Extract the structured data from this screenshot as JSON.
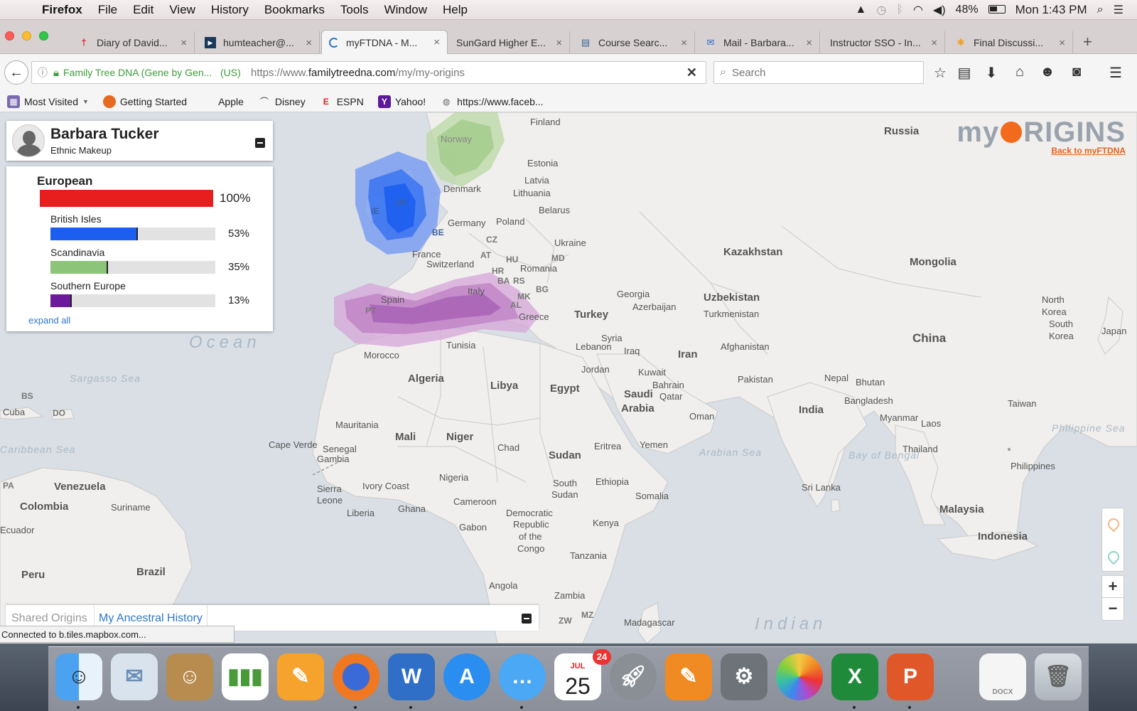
{
  "menubar": {
    "app": "Firefox",
    "items": [
      "File",
      "Edit",
      "View",
      "History",
      "Bookmarks",
      "Tools",
      "Window",
      "Help"
    ],
    "battery": "48%",
    "clock": "Mon 1:43 PM"
  },
  "tabs": [
    {
      "label": "Diary of David...",
      "icon": "cross-icon",
      "color": "#d22"
    },
    {
      "label": "humteacher@...",
      "icon": "play-icon",
      "color": "#1a3a5a"
    },
    {
      "label": "myFTDNA - M...",
      "icon": "loading-icon",
      "color": "#2b78c8"
    },
    {
      "label": "SunGard Higher E...",
      "icon": "",
      "color": ""
    },
    {
      "label": "Course Searc...",
      "icon": "document-icon",
      "color": "#3a6a9a"
    },
    {
      "label": "Mail - Barbara...",
      "icon": "mail-icon",
      "color": "#2b6ac8"
    },
    {
      "label": "Instructor SSO - In...",
      "icon": "",
      "color": ""
    },
    {
      "label": "Final Discussi...",
      "icon": "star-icon",
      "color": "#f0a020"
    }
  ],
  "nav": {
    "identity": "Family Tree DNA (Gene by Gen...",
    "identity_country": "(US)",
    "url_prefix": "https://www.",
    "url_domain": "familytreedna.com",
    "url_path": "/my/my-origins",
    "search_placeholder": "Search"
  },
  "bookmarks": [
    {
      "label": "Most Visited",
      "icon": "most-visited-icon",
      "color": "#7a6ab0"
    },
    {
      "label": "Getting Started",
      "icon": "firefox-icon",
      "color": "#e66a20"
    },
    {
      "label": "Apple",
      "icon": "apple-icon",
      "color": "#555"
    },
    {
      "label": "Disney",
      "icon": "disney-icon",
      "color": "#333"
    },
    {
      "label": "ESPN",
      "icon": "espn-icon",
      "color": "#d22"
    },
    {
      "label": "Yahoo!",
      "icon": "yahoo-icon",
      "color": "#5a1a9a"
    },
    {
      "label": "https://www.faceb...",
      "icon": "globe-icon",
      "color": "#666"
    }
  ],
  "logo": {
    "pre": "my",
    "post": "RIGINS",
    "back": "Back to myFTDNA"
  },
  "user": {
    "name": "Barbara Tucker",
    "subtitle": "Ethnic Makeup"
  },
  "ethnic": {
    "group": "European",
    "group_pct": "100%",
    "group_value": 100,
    "group_color": "#e81e1e",
    "subs": [
      {
        "label": "British Isles",
        "pct": "53%",
        "value": 53,
        "color": "#1b5ef0"
      },
      {
        "label": "Scandinavia",
        "pct": "35%",
        "value": 35,
        "color": "#8cc47a"
      },
      {
        "label": "Southern Europe",
        "pct": "13%",
        "value": 13,
        "color": "#6b1a9b"
      }
    ],
    "expand": "expand all"
  },
  "map_labels": {
    "countries": [
      "Russia",
      "Kazakhstan",
      "Mongolia",
      "China",
      "India",
      "Uzbekistan",
      "Turkmenistan",
      "Afghanistan",
      "Pakistan",
      "Iran",
      "Iraq",
      "Turkey",
      "Georgia",
      "Azerbaijan",
      "Syria",
      "Lebanon",
      "Jordan",
      "Kuwait",
      "Bahrain",
      "Qatar",
      "Saudi",
      "Arabia",
      "Oman",
      "Yemen",
      "Egypt",
      "Libya",
      "Algeria",
      "Tunisia",
      "Morocco",
      "Mauritania",
      "Mali",
      "Niger",
      "Chad",
      "Sudan",
      "South",
      "Sudan",
      "Eritrea",
      "Ethiopia",
      "Somalia",
      "Kenya",
      "Tanzania",
      "Angola",
      "Zambia",
      "Nigeria",
      "Cameroon",
      "Gabon",
      "Ghana",
      "Ivory Coast",
      "Liberia",
      "Sierra",
      "Leone",
      "Senegal",
      "Gambia",
      "Cape Verde",
      "Democratic",
      "Republic",
      "of the",
      "Congo",
      "Nepal",
      "Bhutan",
      "Bangladesh",
      "Myanmar",
      "Laos",
      "Thailand",
      "Philippines",
      "Malaysia",
      "Indonesia",
      "Sri Lanka",
      "Taiwan",
      "North",
      "Korea",
      "South",
      "Korea",
      "Japan",
      "Finland",
      "Norway",
      "Estonia",
      "Latvia",
      "Lithuania",
      "Belarus",
      "Denmark",
      "Poland",
      "Germany",
      "Ukraine",
      "France",
      "Switzerland",
      "Romania",
      "Spain",
      "Italy",
      "Greece",
      "Venezuela",
      "Colombia",
      "Suriname",
      "Ecuador",
      "Peru",
      "Brazil",
      "Cuba",
      "Madagascar"
    ],
    "codes": [
      "UK",
      "IE",
      "BE",
      "CZ",
      "AT",
      "HU",
      "HR",
      "BA",
      "RS",
      "MD",
      "BG",
      "MK",
      "AL",
      "PT",
      "BS",
      "DO",
      "PA",
      "MZ",
      "ZW"
    ],
    "seas": [
      "Sargasso Sea",
      "Caribbean Sea",
      "Arabian Sea",
      "Bay of Bengal",
      "Philippine Sea"
    ],
    "oceans": [
      "Ocean",
      "Indian"
    ]
  },
  "bottom_tabs": {
    "shared": "Shared Origins",
    "ancestral": "My Ancestral History"
  },
  "status": "Connected to b.tiles.mapbox.com...",
  "dock": {
    "calendar_month": "JUL",
    "calendar_day": "25",
    "badge": "24",
    "docx": "DOCX"
  }
}
